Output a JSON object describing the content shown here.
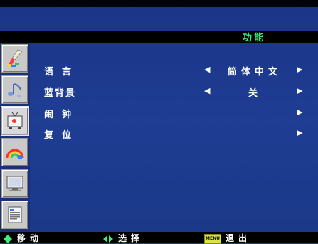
{
  "header": {
    "title": "功能"
  },
  "sidebar": {
    "items": [
      {
        "icon": "brush-icon",
        "active": false
      },
      {
        "icon": "music-note-icon",
        "active": false
      },
      {
        "icon": "tv-icon",
        "active": true
      },
      {
        "icon": "rainbow-icon",
        "active": false
      },
      {
        "icon": "monitor-icon",
        "active": false
      },
      {
        "icon": "document-icon",
        "active": false
      }
    ]
  },
  "menu": {
    "rows": [
      {
        "label": "语言",
        "value": "简体中文",
        "has_left_arrow": true
      },
      {
        "label": "蓝背景",
        "value": "关",
        "has_left_arrow": true
      },
      {
        "label": "闹钟",
        "value": "",
        "has_left_arrow": false
      },
      {
        "label": "复位",
        "value": "",
        "has_left_arrow": false
      }
    ],
    "left_arrow": "◀",
    "right_arrow": "▶"
  },
  "footer": {
    "move_label": "移动",
    "select_label": "选择",
    "menu_badge": "MENU",
    "exit_label": "退出"
  },
  "colors": {
    "background": "#1d3a8c",
    "title_accent": "#3cf07a",
    "footer_icon_accent": "#3cf07a"
  }
}
